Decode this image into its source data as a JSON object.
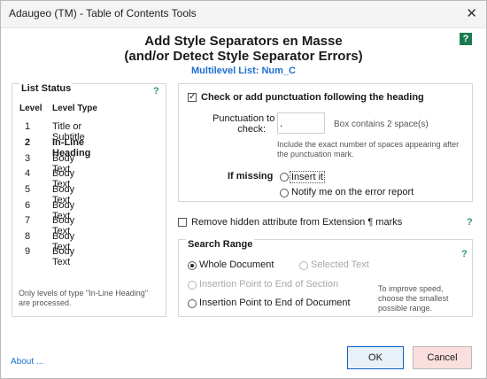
{
  "window": {
    "title": "Adaugeo (TM) - Table of Contents Tools"
  },
  "header": {
    "line1": "Add Style Separators en Masse",
    "line2": "(and/or Detect Style Separator Errors)",
    "multilevel": "Multilevel List:  Num_C",
    "help": "?"
  },
  "list_status": {
    "title": "List Status",
    "help": "?",
    "col_level": "Level",
    "col_type": "Level Type",
    "rows": [
      {
        "level": "1",
        "type": "Title or Subtitle"
      },
      {
        "level": "2",
        "type": "In-Line Heading"
      },
      {
        "level": "3",
        "type": "Body Text"
      },
      {
        "level": "4",
        "type": "Body Text"
      },
      {
        "level": "5",
        "type": "Body Text"
      },
      {
        "level": "6",
        "type": "Body Text"
      },
      {
        "level": "7",
        "type": "Body Text"
      },
      {
        "level": "8",
        "type": "Body Text"
      },
      {
        "level": "9",
        "type": "Body Text"
      }
    ],
    "note": "Only levels of type \"In-Line Heading\" are processed."
  },
  "punct": {
    "check_label": "Check or add punctuation following the heading",
    "checked": true,
    "punct_label_1": "Punctuation to",
    "punct_label_2": "check:",
    "punct_value": ".",
    "box_info": "Box contains 2 space(s)",
    "hint": "Include the exact number of spaces appearing after the punctuation mark.",
    "if_missing": "If missing",
    "opt_insert": "Insert it",
    "opt_notify": "Notify me on the error report"
  },
  "hidden": {
    "label": "Remove hidden attribute from Extension ¶ marks",
    "checked": false,
    "help": "?"
  },
  "search": {
    "title": "Search Range",
    "help": "?",
    "whole": "Whole Document",
    "selected": "Selected Text",
    "ip_section": "Insertion Point to End of Section",
    "ip_doc": "Insertion Point to End of Document",
    "hint": "To improve speed, choose the smallest possible range."
  },
  "footer": {
    "about": "About ...",
    "ok": "OK",
    "cancel": "Cancel"
  }
}
